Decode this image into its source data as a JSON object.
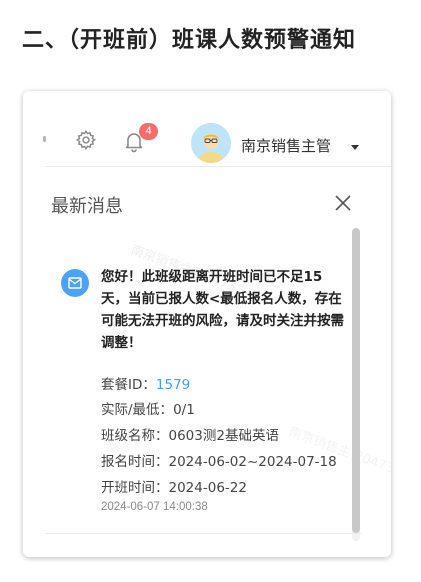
{
  "heading": "二、（开班前）班课人数预警通知",
  "watermark": "南京销售主管0473",
  "header": {
    "badge_count": "4",
    "user_name": "南京销售主管"
  },
  "panel": {
    "title": "最新消息"
  },
  "message": {
    "body": "您好！此班级距离开班时间已不足15天，当前已报人数<最低报名人数，存在可能无法开班的风险，请及时关注并按需调整！",
    "fields": [
      {
        "label": "套餐ID：",
        "value": "1579"
      },
      {
        "label": "实际/最低：",
        "value": "0/1"
      },
      {
        "label": "班级名称：",
        "value": "0603测2基础英语"
      },
      {
        "label": "报名时间：",
        "value": "2024-06-02~2024-07-18"
      },
      {
        "label": "开班时间：",
        "value": "2024-06-22"
      }
    ],
    "timestamp": "2024-06-07 14:00:38"
  },
  "colors": {
    "badge": "#f56c6c",
    "link": "#409eff",
    "message_icon": "#4aa3f3"
  },
  "icons": [
    "gear-icon",
    "bell-icon",
    "caret-down-icon",
    "close-icon",
    "mail-icon"
  ]
}
